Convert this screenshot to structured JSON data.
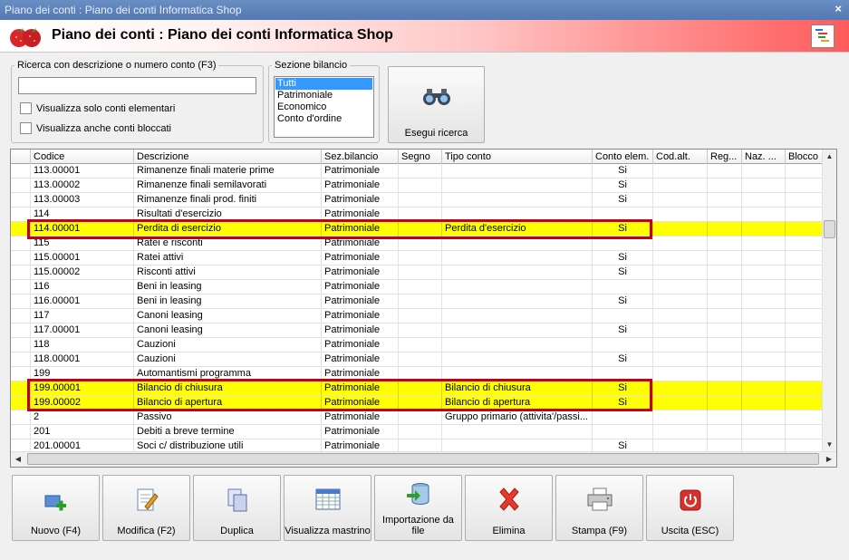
{
  "window": {
    "title": "Piano dei conti : Piano dei conti Informatica Shop",
    "close_glyph": "×"
  },
  "header": {
    "title": "Piano dei conti : Piano dei conti Informatica Shop"
  },
  "search": {
    "legend": "Ricerca con descrizione o numero conto (F3)",
    "value": "",
    "chk_elementari": "Visualizza solo conti elementari",
    "chk_bloccati": "Visualizza anche conti bloccati"
  },
  "sezione": {
    "legend": "Sezione bilancio",
    "options": [
      "Tutti",
      "Patrimoniale",
      "Economico",
      "Conto d'ordine"
    ],
    "selected": "Tutti"
  },
  "esegui_label": "Esegui ricerca",
  "grid": {
    "columns": [
      "Codice",
      "Descrizione",
      "Sez.bilancio",
      "Segno",
      "Tipo conto",
      "Conto elem.",
      "Cod.alt.",
      "Reg...",
      "Naz. ...",
      "Blocco"
    ],
    "rows": [
      {
        "codice": "113.00001",
        "descrizione": "Rimanenze finali materie prime",
        "sez": "Patrimoniale",
        "segno": "",
        "tipo": "",
        "elem": "Si",
        "hl": false
      },
      {
        "codice": "113.00002",
        "descrizione": "Rimanenze finali semilavorati",
        "sez": "Patrimoniale",
        "segno": "",
        "tipo": "",
        "elem": "Si",
        "hl": false
      },
      {
        "codice": "113.00003",
        "descrizione": "Rimanenze finali prod. finiti",
        "sez": "Patrimoniale",
        "segno": "",
        "tipo": "",
        "elem": "Si",
        "hl": false
      },
      {
        "codice": "114",
        "descrizione": "Risultati d'esercizio",
        "sez": "Patrimoniale",
        "segno": "",
        "tipo": "",
        "elem": "",
        "hl": false
      },
      {
        "codice": "114.00001",
        "descrizione": "Perdita di esercizio",
        "sez": "Patrimoniale",
        "segno": "",
        "tipo": "Perdita d'esercizio",
        "elem": "Si",
        "hl": true
      },
      {
        "codice": "115",
        "descrizione": "Ratei e risconti",
        "sez": "Patrimoniale",
        "segno": "",
        "tipo": "",
        "elem": "",
        "hl": false
      },
      {
        "codice": "115.00001",
        "descrizione": "Ratei attivi",
        "sez": "Patrimoniale",
        "segno": "",
        "tipo": "",
        "elem": "Si",
        "hl": false
      },
      {
        "codice": "115.00002",
        "descrizione": "Risconti attivi",
        "sez": "Patrimoniale",
        "segno": "",
        "tipo": "",
        "elem": "Si",
        "hl": false
      },
      {
        "codice": "116",
        "descrizione": "Beni in leasing",
        "sez": "Patrimoniale",
        "segno": "",
        "tipo": "",
        "elem": "",
        "hl": false
      },
      {
        "codice": "116.00001",
        "descrizione": "Beni in leasing",
        "sez": "Patrimoniale",
        "segno": "",
        "tipo": "",
        "elem": "Si",
        "hl": false
      },
      {
        "codice": "117",
        "descrizione": "Canoni leasing",
        "sez": "Patrimoniale",
        "segno": "",
        "tipo": "",
        "elem": "",
        "hl": false
      },
      {
        "codice": "117.00001",
        "descrizione": "Canoni leasing",
        "sez": "Patrimoniale",
        "segno": "",
        "tipo": "",
        "elem": "Si",
        "hl": false
      },
      {
        "codice": "118",
        "descrizione": "Cauzioni",
        "sez": "Patrimoniale",
        "segno": "",
        "tipo": "",
        "elem": "",
        "hl": false
      },
      {
        "codice": "118.00001",
        "descrizione": "Cauzioni",
        "sez": "Patrimoniale",
        "segno": "",
        "tipo": "",
        "elem": "Si",
        "hl": false
      },
      {
        "codice": "199",
        "descrizione": "Automantismi programma",
        "sez": "Patrimoniale",
        "segno": "",
        "tipo": "",
        "elem": "",
        "hl": false
      },
      {
        "codice": "199.00001",
        "descrizione": "Bilancio di chiusura",
        "sez": "Patrimoniale",
        "segno": "",
        "tipo": "Bilancio di chiusura",
        "elem": "Si",
        "hl": true
      },
      {
        "codice": "199.00002",
        "descrizione": "Bilancio di apertura",
        "sez": "Patrimoniale",
        "segno": "",
        "tipo": "Bilancio di apertura",
        "elem": "Si",
        "hl": true
      },
      {
        "codice": "2",
        "descrizione": "Passivo",
        "sez": "Patrimoniale",
        "segno": "",
        "tipo": "Gruppo primario (attivita'/passi...",
        "elem": "",
        "hl": false
      },
      {
        "codice": "201",
        "descrizione": "Debiti a breve termine",
        "sez": "Patrimoniale",
        "segno": "",
        "tipo": "",
        "elem": "",
        "hl": false
      },
      {
        "codice": "201.00001",
        "descrizione": "Soci c/ distribuzione utili",
        "sez": "Patrimoniale",
        "segno": "",
        "tipo": "",
        "elem": "Si",
        "hl": false
      }
    ]
  },
  "toolbar": {
    "nuovo": "Nuovo (F4)",
    "modifica": "Modifica (F2)",
    "duplica": "Duplica",
    "mastrino": "Visualizza mastrino",
    "importazione": "Importazione da file",
    "elimina": "Elimina",
    "stampa": "Stampa (F9)",
    "uscita": "Uscita (ESC)"
  },
  "colors": {
    "highlight": "#ffff00",
    "annotation_border": "#c0001a",
    "selection": "#3399ff"
  }
}
